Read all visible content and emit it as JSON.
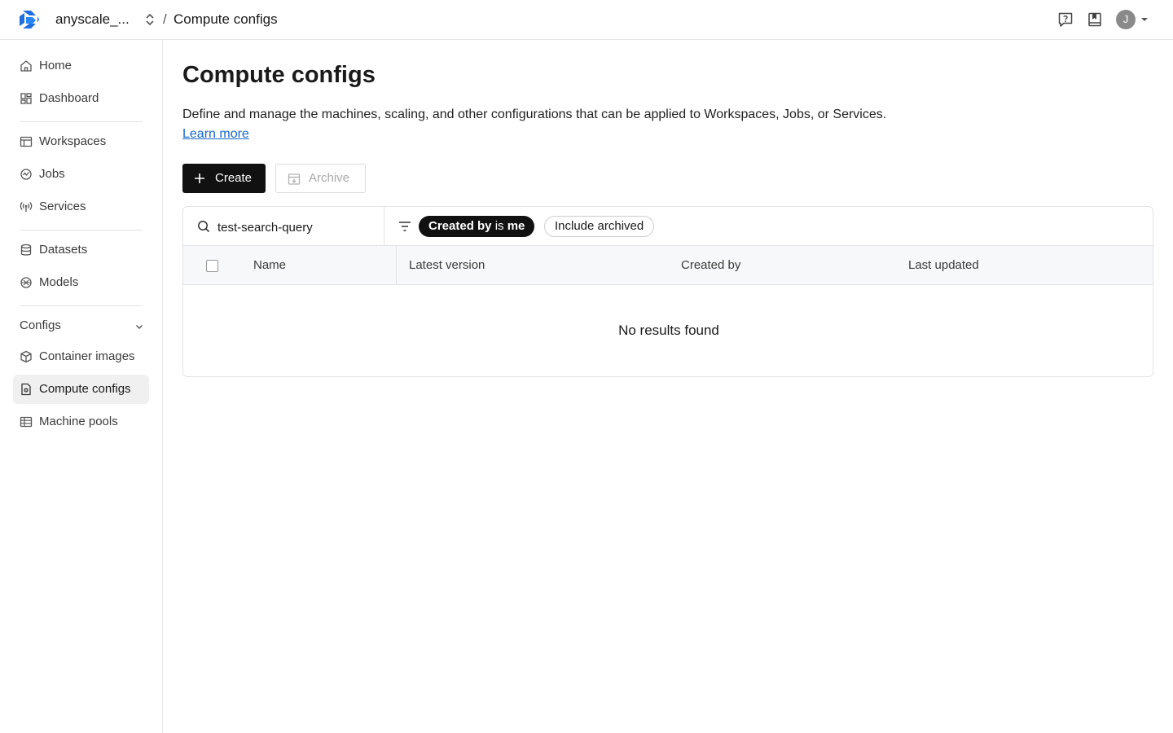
{
  "header": {
    "org_name": "anyscale_...",
    "breadcrumb_separator": "/",
    "breadcrumb_current": "Compute configs",
    "avatar_initial": "J"
  },
  "sidebar": {
    "items": [
      {
        "label": "Home",
        "icon": "home-icon"
      },
      {
        "label": "Dashboard",
        "icon": "dashboard-icon"
      },
      {
        "label": "Workspaces",
        "icon": "workspaces-icon"
      },
      {
        "label": "Jobs",
        "icon": "jobs-icon"
      },
      {
        "label": "Services",
        "icon": "services-icon"
      },
      {
        "label": "Datasets",
        "icon": "database-icon"
      },
      {
        "label": "Models",
        "icon": "models-icon"
      }
    ],
    "configs_section": {
      "label": "Configs",
      "items": [
        {
          "label": "Container images",
          "icon": "cube-icon"
        },
        {
          "label": "Compute configs",
          "icon": "compute-config-icon",
          "active": true
        },
        {
          "label": "Machine pools",
          "icon": "machine-pools-icon"
        }
      ]
    }
  },
  "main": {
    "title": "Compute configs",
    "description": "Define and manage the machines, scaling, and other configurations that can be applied to Workspaces, Jobs, or Services.",
    "learn_more": "Learn more",
    "create_label": "Create",
    "archive_label": "Archive",
    "search": {
      "value": "test-search-query"
    },
    "filters": {
      "chip_key": "Created by",
      "chip_op": "is",
      "chip_value": "me",
      "include_archived": "Include archived"
    },
    "table": {
      "columns": [
        "Name",
        "Latest version",
        "Created by",
        "Last updated"
      ],
      "empty_message": "No results found"
    }
  },
  "colors": {
    "primary_button": "#111111",
    "link": "#1769c8",
    "active_nav_bg": "#f0f0f0",
    "logo": "#1f6fe0"
  }
}
